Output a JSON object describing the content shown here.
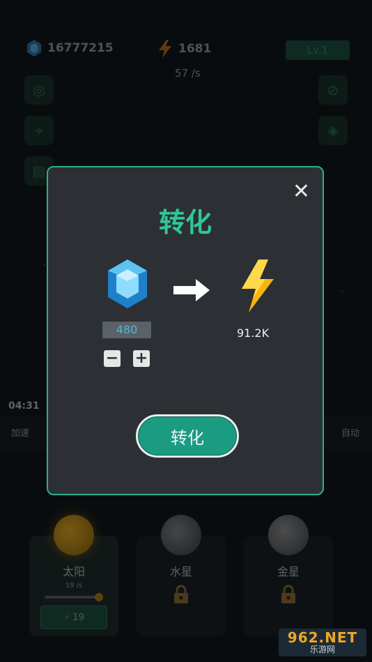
{
  "resources": {
    "gems": "16777215",
    "energy": "1681",
    "energy_rate": "57 /s",
    "level": "Lv.1"
  },
  "timer": "04:31",
  "speed_row": {
    "left_label": "加速",
    "right_label": "自动"
  },
  "planets": [
    {
      "name": "太阳",
      "rate": "19 /s",
      "cost": "19",
      "locked": false
    },
    {
      "name": "水星",
      "locked": true
    },
    {
      "name": "金星",
      "locked": true
    }
  ],
  "modal": {
    "title": "转化",
    "amount": "480",
    "result": "91.2K",
    "button": "转化"
  },
  "watermark": {
    "main": "962.NET",
    "sub": "乐游网"
  },
  "colors": {
    "accent": "#2fc898",
    "border": "#2bb18a",
    "button": "#1b9b82"
  }
}
